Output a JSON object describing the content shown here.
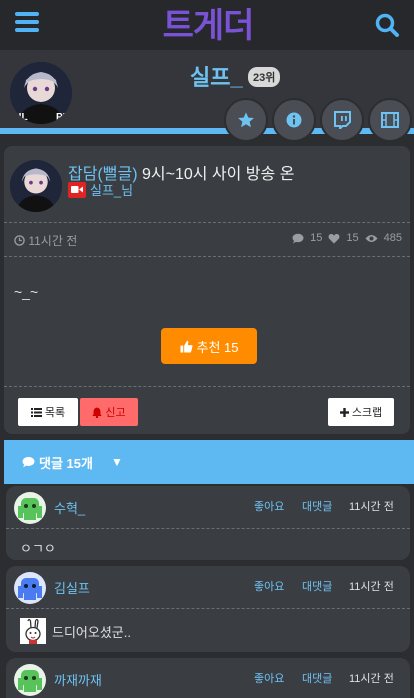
{
  "header": {
    "logo": "트게더"
  },
  "profile": {
    "username": "실프_",
    "rank": "23위"
  },
  "post": {
    "category": "잡담(뻘글)",
    "title": "9시~10시 사이 방송 온",
    "author": "실프_님",
    "time": "11시간 전",
    "comment_count": "15",
    "like_count": "15",
    "view_count": "485",
    "body": "~_~",
    "recommend_label": "추천 15",
    "list_label": "목록",
    "report_label": "신고",
    "scrap_label": "스크랩"
  },
  "comments_bar": {
    "label": "댓글 15개"
  },
  "comments": [
    {
      "name": "수혁_",
      "like": "좋아요",
      "reply": "대댓글",
      "time": "11시간 전",
      "text": "ㅇㄱㅇ",
      "avatar_color": "#58c35a"
    },
    {
      "name": "김실프",
      "like": "좋아요",
      "reply": "대댓글",
      "time": "11시간 전",
      "text": "드디어오셨군..",
      "avatar_color": "#4a7cf0"
    },
    {
      "name": "까재까재",
      "like": "좋아요",
      "reply": "대댓글",
      "time": "11시간 전",
      "text": "",
      "avatar_color": "#58c35a"
    }
  ],
  "colors": {
    "accent": "#5eb8f2",
    "brand": "#7a52d6",
    "recommend": "#ff8c00",
    "report": "#ff6b6b"
  }
}
